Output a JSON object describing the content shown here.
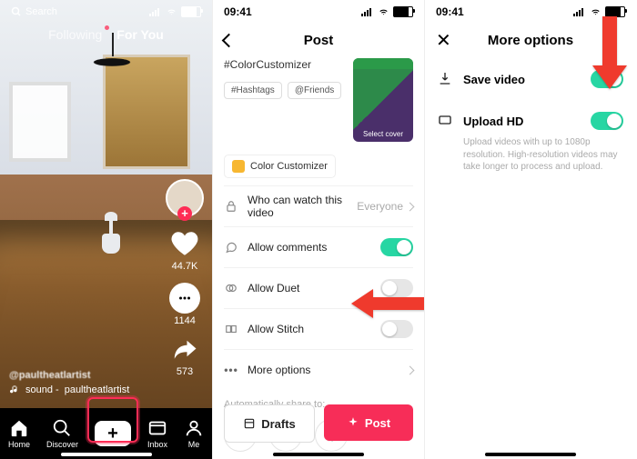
{
  "status": {
    "time": "09:41",
    "search": "Search"
  },
  "feed": {
    "tabs": {
      "following": "Following",
      "foryou": "For You"
    },
    "likes": "44.7K",
    "comments": "1144",
    "shares": "573",
    "username": "@paultheatlartist",
    "sound_prefix": "sound - ",
    "sound_artist": "paultheatlartist"
  },
  "nav": {
    "home": "Home",
    "discover": "Discover",
    "inbox": "Inbox",
    "me": "Me"
  },
  "post": {
    "title": "Post",
    "caption": "#ColorCustomizer",
    "cover_label": "Select cover",
    "chips": {
      "hashtags": "#Hashtags",
      "friends": "@Friends"
    },
    "color_customizer": "Color Customizer",
    "who": "Who can watch this video",
    "who_value": "Everyone",
    "allow_comments": "Allow comments",
    "allow_duet": "Allow Duet",
    "allow_stitch": "Allow Stitch",
    "more_options": "More options",
    "auto_share": "Automatically share to:",
    "drafts": "Drafts",
    "post_btn": "Post"
  },
  "more": {
    "title": "More options",
    "save_video": "Save video",
    "upload_hd": "Upload HD",
    "upload_hd_desc": "Upload videos with up to 1080p resolution. High-resolution videos may take longer to process and upload."
  }
}
